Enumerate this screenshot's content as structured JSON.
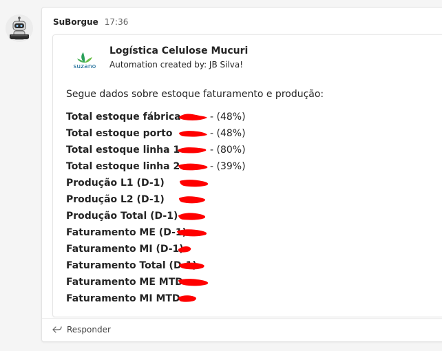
{
  "message": {
    "sender": "SuBorgue",
    "time": "17:36",
    "avatar_icon": "robot-avatar-icon",
    "reply_label": "Responder"
  },
  "card": {
    "logo_text": "suzano",
    "logo_color": "#2aa05a",
    "title": "Logística Celulose Mucuri",
    "subtitle": "Automation created by: JB Silva!",
    "intro": "Segue dados sobre estoque faturamento e produção:",
    "redaction_color": "#ff0000",
    "rows": [
      {
        "label": "Total estoque fábrica",
        "extra": "- (48%)"
      },
      {
        "label": "Total estoque porto",
        "extra": "- (48%)"
      },
      {
        "label": "Total estoque linha 1",
        "extra": "- (80%)"
      },
      {
        "label": "Total estoque linha 2",
        "extra": "- (39%)"
      },
      {
        "label": "Produção L1 (D-1)",
        "extra": ""
      },
      {
        "label": "Produção L2 (D-1)",
        "extra": ""
      },
      {
        "label": "Produção Total (D-1)",
        "extra": ""
      },
      {
        "label": "Faturamento ME (D-1)",
        "extra": ""
      },
      {
        "label": "Faturamento MI (D-1)",
        "extra": ""
      },
      {
        "label": "Faturamento Total (D-1)",
        "extra": ""
      },
      {
        "label": "Faturamento ME MTD",
        "extra": ""
      },
      {
        "label": "Faturamento MI MTD",
        "extra": ""
      }
    ]
  }
}
